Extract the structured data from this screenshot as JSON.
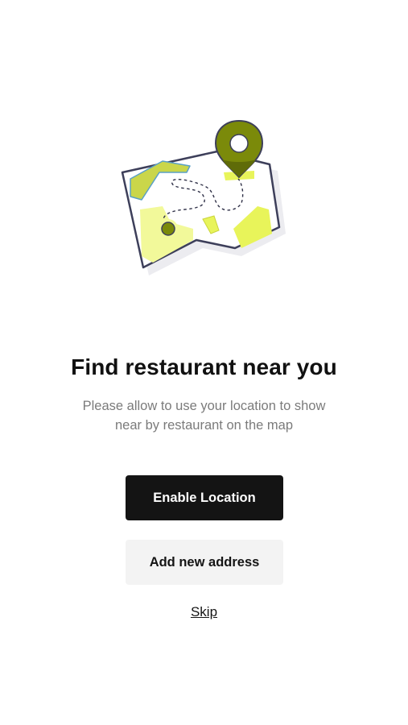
{
  "illustration": {
    "icon": "map-with-location-pin-icon",
    "colors": {
      "outline": "#3d3f5a",
      "pin": "#7b8a0a",
      "pin_dark": "#5f6b08",
      "accent": "#e8f45a",
      "accent_light": "#f2f99a",
      "water": "#5aa0c6",
      "shadow": "#e6e6ea"
    }
  },
  "content": {
    "title": "Find restaurant near you",
    "subtitle": "Please allow to use your location to show near by restaurant on the map"
  },
  "actions": {
    "enable_location_label": "Enable Location",
    "add_address_label": "Add new address",
    "skip_label": "Skip"
  }
}
